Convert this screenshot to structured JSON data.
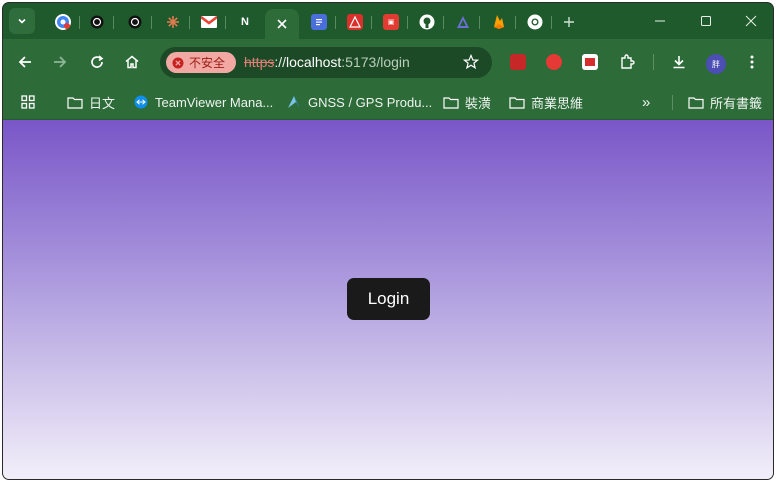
{
  "tabs": [
    {
      "icon": "chrome-red-icon",
      "active": false
    },
    {
      "icon": "chatgpt-icon",
      "active": false
    },
    {
      "icon": "chatgpt-icon",
      "active": false
    },
    {
      "icon": "claude-icon",
      "active": false
    },
    {
      "icon": "gmail-icon",
      "active": false
    },
    {
      "icon": "notion-icon",
      "label": "N",
      "active": false
    },
    {
      "icon": "close-icon",
      "active": true
    },
    {
      "icon": "docs-icon",
      "active": false
    },
    {
      "icon": "warning-app-icon",
      "active": false
    },
    {
      "icon": "red-app-icon",
      "active": false
    },
    {
      "icon": "github-icon",
      "active": false
    },
    {
      "icon": "triangle-app-icon",
      "active": false
    },
    {
      "icon": "firebase-icon",
      "active": false
    },
    {
      "icon": "chrome-icon",
      "active": false
    }
  ],
  "omnibox": {
    "security_label": "不安全",
    "url_scheme": "https",
    "url_separator": "://",
    "url_host": "localhost",
    "url_rest": ":5173/login"
  },
  "bookmarks": {
    "items": [
      {
        "label": "日文",
        "icon": "folder-icon"
      },
      {
        "label": "TeamViewer Mana...",
        "icon": "teamviewer-icon"
      },
      {
        "label": "GNSS / GPS Produ...",
        "icon": "gnss-icon"
      },
      {
        "label": "裝潢",
        "icon": "folder-icon"
      },
      {
        "label": "商業思維",
        "icon": "folder-icon"
      }
    ],
    "overflow": "»",
    "all_bookmarks": "所有書籤"
  },
  "profile_initial": "胖",
  "page": {
    "login_label": "Login"
  },
  "colors": {
    "frame": "#1f5c2d",
    "toolbar": "#2d6b39",
    "gradient_top": "#7a56c8",
    "gradient_bottom": "#f2eff9",
    "button_bg": "#1a1a1a"
  }
}
